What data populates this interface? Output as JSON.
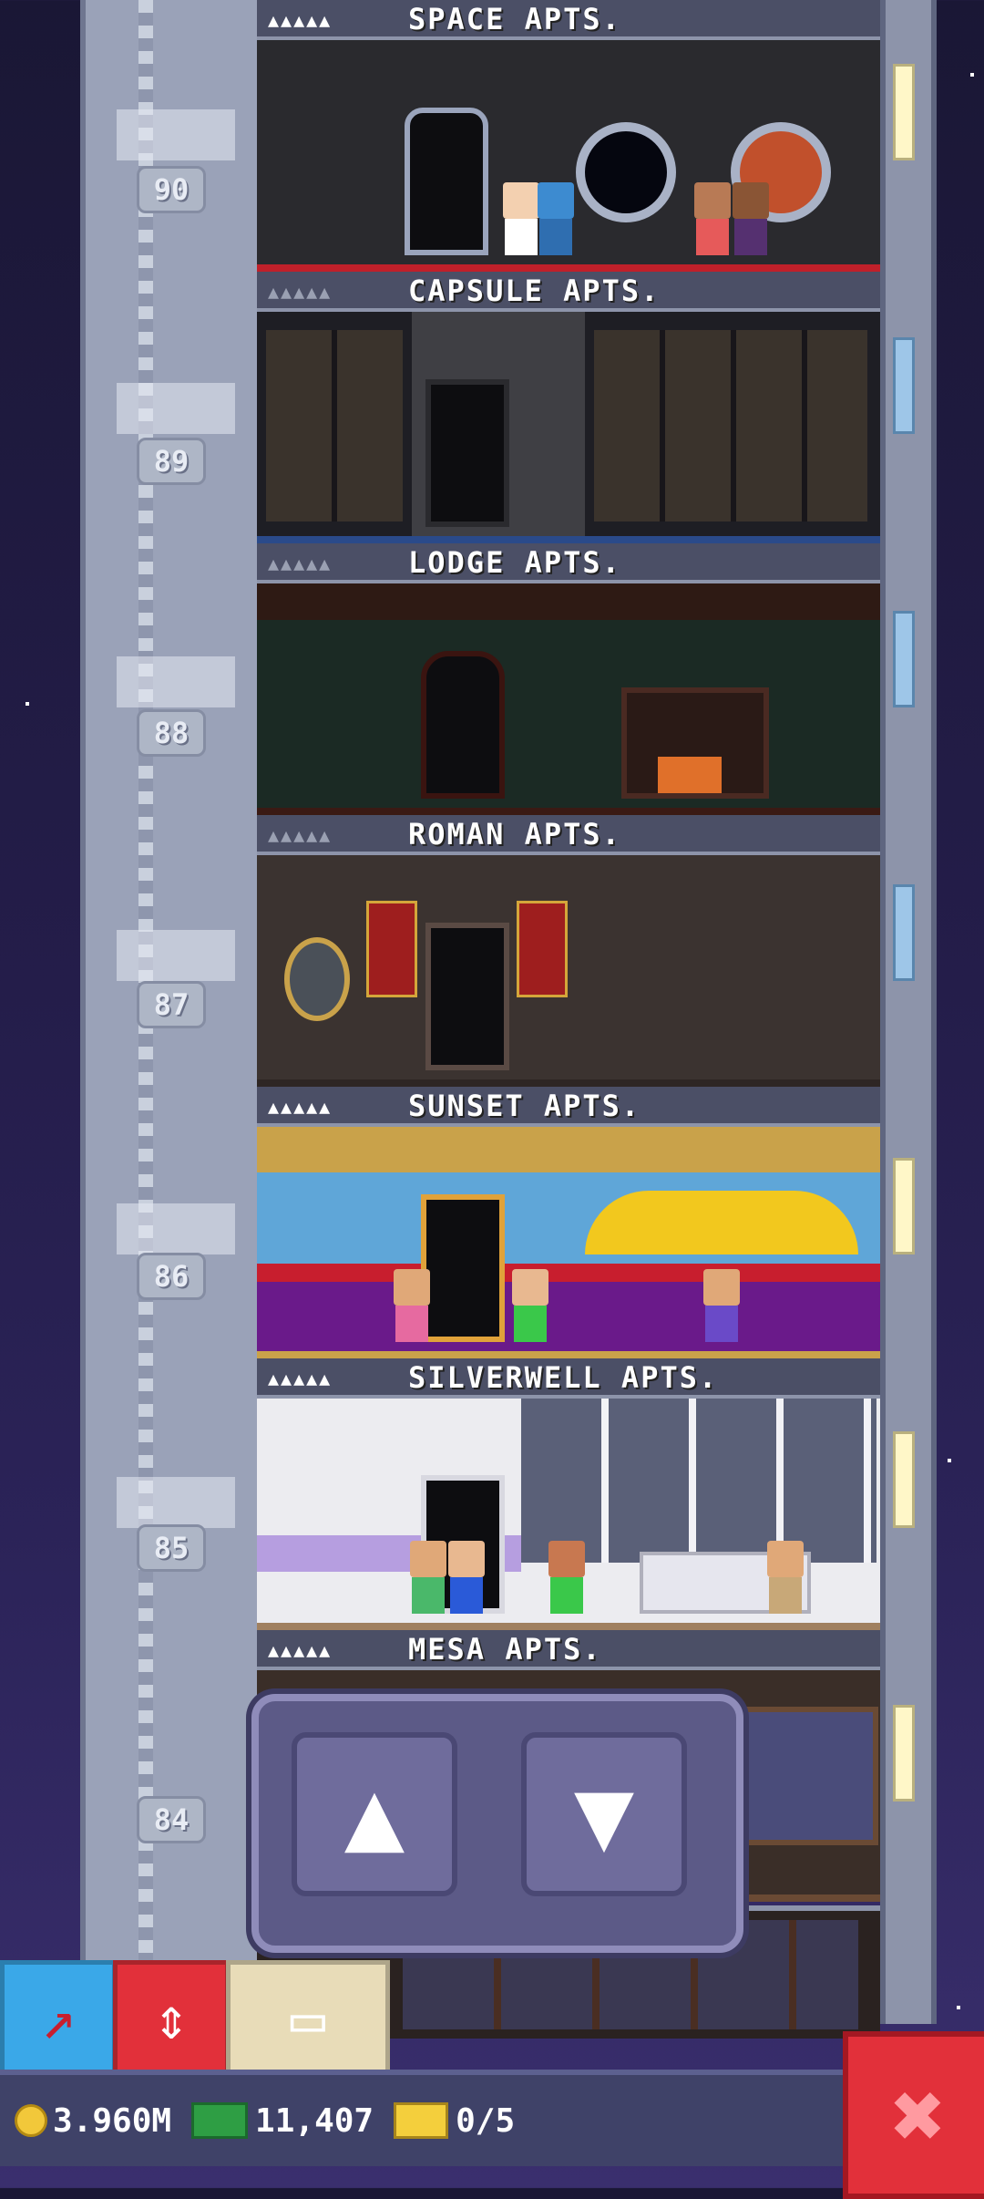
{
  "floors": [
    {
      "name": "SPACE APTS.",
      "number": "90",
      "rating_full": true
    },
    {
      "name": "CAPSULE APTS.",
      "number": "89",
      "rating_full": false
    },
    {
      "name": "LODGE APTS.",
      "number": "88",
      "rating_full": false
    },
    {
      "name": "ROMAN APTS.",
      "number": "87",
      "rating_full": false
    },
    {
      "name": "SUNSET APTS.",
      "number": "86",
      "rating_full": true
    },
    {
      "name": "SILVERWELL APTS.",
      "number": "85",
      "rating_full": true
    },
    {
      "name": "MESA APTS.",
      "number": "84",
      "rating_full": true
    }
  ],
  "rating_dots": "▲▲▲▲▲",
  "elevator_panel": {
    "up_icon": "▲",
    "down_icon": "▼"
  },
  "toolbar": {
    "pick_icon": "↗",
    "elevator_icon": "⇕",
    "box_icon": "▭"
  },
  "status": {
    "coins": "3.960M",
    "bux": "11,407",
    "tickets": "0/5"
  },
  "close_icon": "✖",
  "colors": {
    "accent_red": "#e2303a",
    "panel": "#5c5a87",
    "toolbar_blue": "#3aa8e8"
  }
}
